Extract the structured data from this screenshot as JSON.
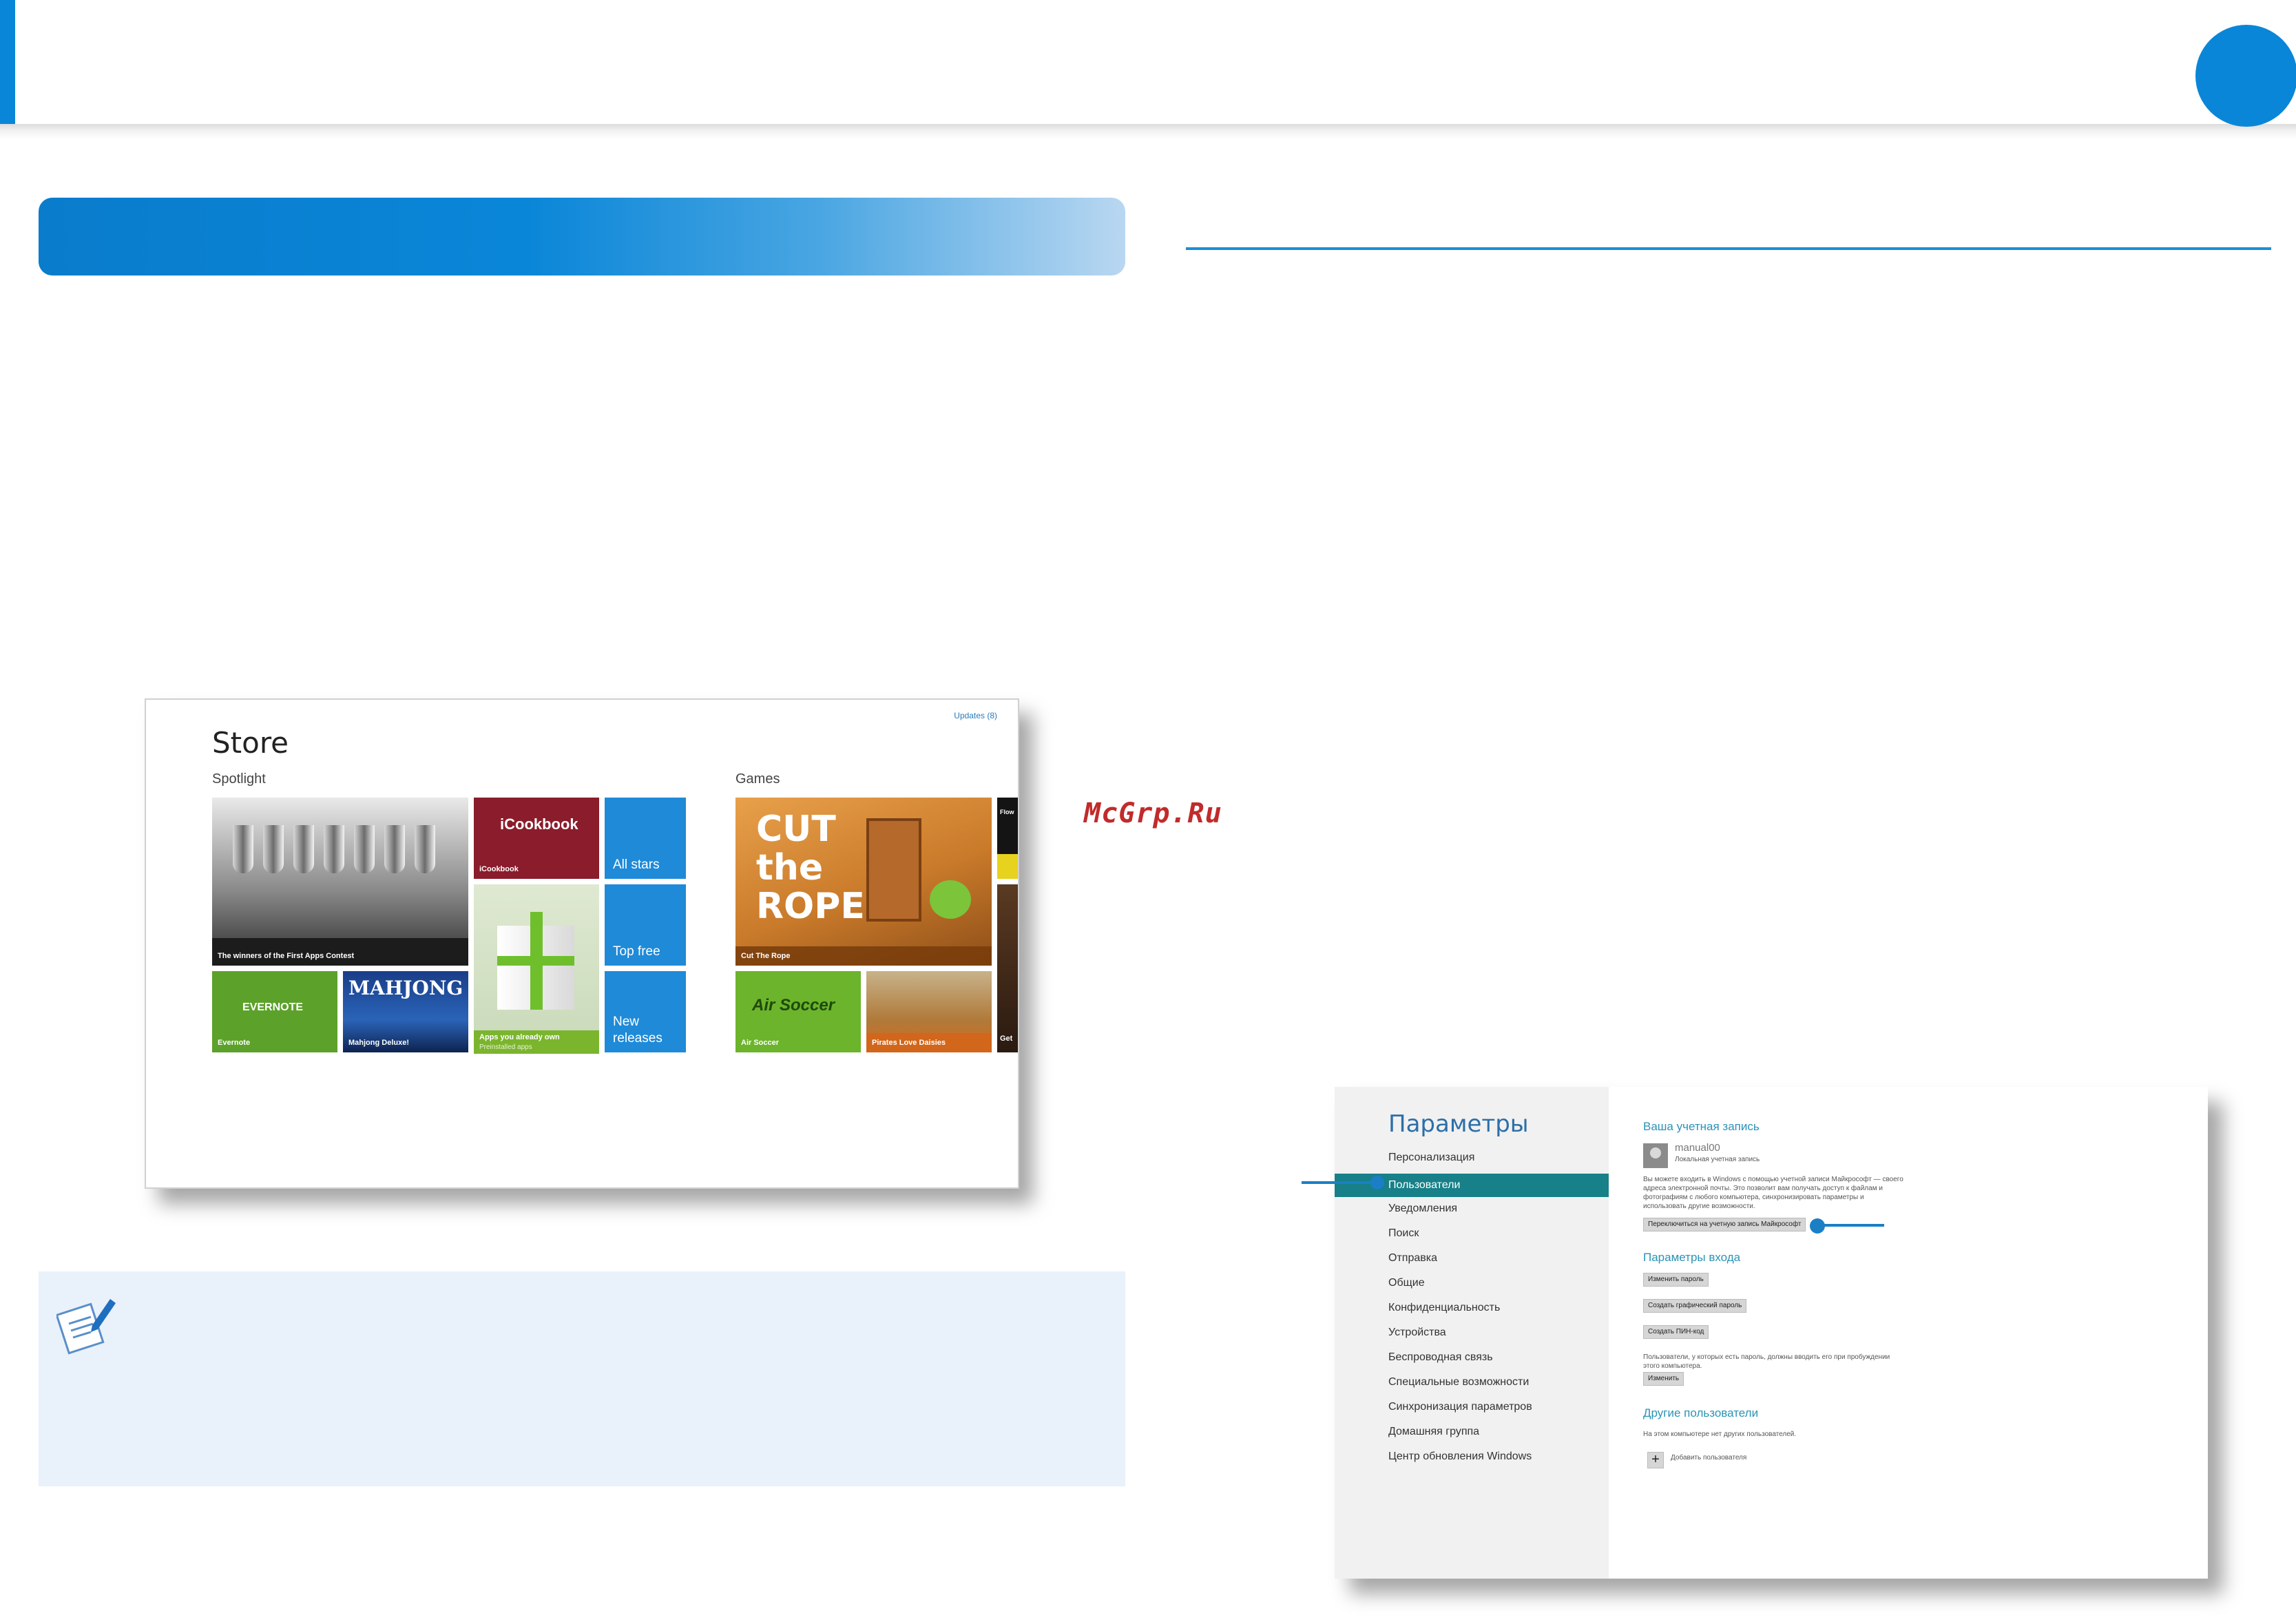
{
  "watermark": "McGrp.Ru",
  "store": {
    "title": "Store",
    "updates": "Updates (8)",
    "spotlight_label": "Spotlight",
    "games_label": "Games",
    "tiles": {
      "winners": "The winners of the First Apps Contest",
      "icookbook_logo": "iCookbook",
      "icookbook": "iCookbook",
      "apps_owned": "Apps you already own",
      "apps_owned_sub": "Preinstalled apps",
      "all_stars": "All stars",
      "top_free": "Top free",
      "new_releases": "New releases",
      "evernote_logo": "EVERNOTE",
      "evernote": "Evernote",
      "mahjong_logo": "MAHJONG",
      "mahjong": "Mahjong Deluxe!",
      "cut_rope_logo": "CUT the ROPE",
      "cut_rope": "Cut The Rope",
      "air_soccer_logo": "Air Soccer",
      "air_soccer": "Air Soccer",
      "pirates": "Pirates Love Daisies",
      "edge_top": "Flow",
      "edge_bottom": "Get"
    }
  },
  "settings": {
    "title": "Параметры",
    "nav": [
      "Персонализация",
      "Пользователи",
      "Уведомления",
      "Поиск",
      "Отправка",
      "Общие",
      "Конфиденциальность",
      "Устройства",
      "Беспроводная связь",
      "Специальные возможности",
      "Синхронизация параметров",
      "Домашняя группа",
      "Центр обновления Windows"
    ],
    "active_index": 1,
    "account_heading": "Ваша учетная запись",
    "user_name": "manual00",
    "user_type": "Локальная учетная запись",
    "account_desc": "Вы можете входить в Windows с помощью учетной записи Майкрософт — своего адреса электронной почты. Это позволит вам получать доступ к файлам и фотографиям с любого компьютера, синхронизировать параметры и использовать другие возможности.",
    "switch_button": "Переключиться на учетную запись Майкрософт",
    "signin_heading": "Параметры входа",
    "change_password": "Изменить пароль",
    "create_picture_password": "Создать графический пароль",
    "create_pin": "Создать ПИН-код",
    "password_note": "Пользователи, у которых есть пароль, должны вводить его при пробуждении этого компьютера.",
    "change_button": "Изменить",
    "other_users_heading": "Другие пользователи",
    "no_other_users": "На этом компьютере нет других пользователей.",
    "add_user": "Добавить пользователя",
    "add_icon": "+"
  }
}
